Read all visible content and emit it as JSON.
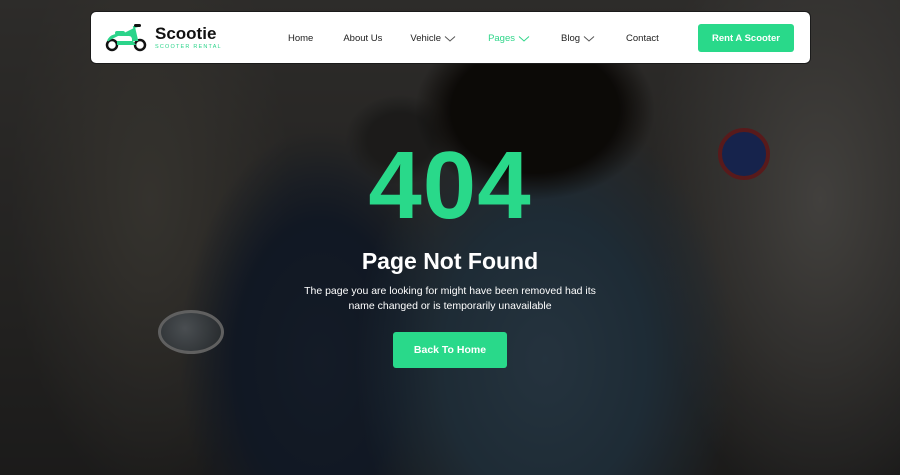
{
  "brand": {
    "name": "Scootie",
    "tagline": "SCOOTER RENTAL",
    "accent_color": "#29d98a"
  },
  "nav": {
    "items": [
      {
        "label": "Home",
        "dropdown": false
      },
      {
        "label": "About Us",
        "dropdown": false
      },
      {
        "label": "Vehicle",
        "dropdown": true
      },
      {
        "label": "Pages",
        "dropdown": true,
        "active": true
      },
      {
        "label": "Blog",
        "dropdown": true
      },
      {
        "label": "Contact",
        "dropdown": false
      }
    ],
    "cta_label": "Rent A Scooter"
  },
  "hero": {
    "code": "404",
    "title": "Page Not Found",
    "description": "The page you are looking for might have been removed had its name changed or is temporarily unavailable",
    "button_label": "Back To Home"
  }
}
